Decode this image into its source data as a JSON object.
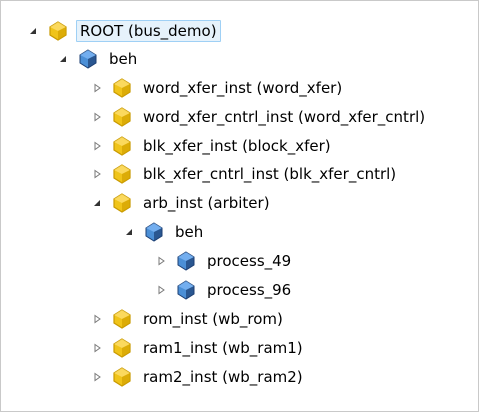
{
  "tree": {
    "root": {
      "label": "ROOT (bus_demo)",
      "expanded": true,
      "selected": true,
      "icon": "instance-icon"
    },
    "beh": {
      "label": "beh",
      "expanded": true,
      "icon": "architecture-icon"
    },
    "word_xfer_inst": {
      "label": "word_xfer_inst (word_xfer)",
      "expanded": false,
      "icon": "instance-icon"
    },
    "word_xfer_cntrl_inst": {
      "label": "word_xfer_cntrl_inst (word_xfer_cntrl)",
      "expanded": false,
      "icon": "instance-icon"
    },
    "blk_xfer_inst": {
      "label": "blk_xfer_inst (block_xfer)",
      "expanded": false,
      "icon": "instance-icon"
    },
    "blk_xfer_cntrl_inst": {
      "label": "blk_xfer_cntrl_inst (blk_xfer_cntrl)",
      "expanded": false,
      "icon": "instance-icon"
    },
    "arb_inst": {
      "label": "arb_inst (arbiter)",
      "expanded": true,
      "icon": "instance-icon"
    },
    "arb_beh": {
      "label": "beh",
      "expanded": true,
      "icon": "architecture-icon"
    },
    "process_49": {
      "label": "process_49",
      "expanded": false,
      "icon": "process-icon"
    },
    "process_96": {
      "label": "process_96",
      "expanded": false,
      "icon": "process-icon"
    },
    "rom_inst": {
      "label": "rom_inst (wb_rom)",
      "expanded": false,
      "icon": "instance-icon"
    },
    "ram1_inst": {
      "label": "ram1_inst (wb_ram1)",
      "expanded": false,
      "icon": "instance-icon"
    },
    "ram2_inst": {
      "label": "ram2_inst (wb_ram2)",
      "expanded": false,
      "icon": "instance-icon"
    }
  },
  "colors": {
    "instance_yellow": "#f0c419",
    "instance_dark": "#c99a00",
    "blue_light": "#4b8fd6",
    "blue_dark": "#1c3f73",
    "selection_bg": "#e6f2fb",
    "selection_border": "#9fd0f5"
  }
}
